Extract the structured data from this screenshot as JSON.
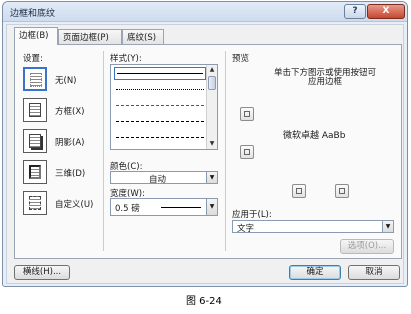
{
  "window": {
    "title": "边框和底纹",
    "help": "?",
    "close": "X"
  },
  "tabs": [
    {
      "label": "边框(B)"
    },
    {
      "label": "页面边框(P)"
    },
    {
      "label": "底纹(S)"
    }
  ],
  "settings": {
    "label": "设置:",
    "items": [
      {
        "label": "无(N)"
      },
      {
        "label": "方框(X)"
      },
      {
        "label": "阴影(A)"
      },
      {
        "label": "三维(D)"
      },
      {
        "label": "自定义(U)"
      }
    ]
  },
  "style": {
    "label": "样式(Y):",
    "up": "▲",
    "down": "▼"
  },
  "color": {
    "label": "颜色(C):",
    "value": "自动",
    "arrow": "▼"
  },
  "width": {
    "label": "宽度(W):",
    "value": "0.5 磅",
    "arrow": "▼"
  },
  "preview": {
    "label": "预览",
    "instruction_line1": "单击下方图示或使用按钮可",
    "instruction_line2": "应用边框",
    "sample": "微软卓越 AaBb"
  },
  "apply_to": {
    "label": "应用于(L):",
    "value": "文字",
    "arrow": "▼"
  },
  "buttons": {
    "options": "选项(O)...",
    "horizontal_line": "横线(H)...",
    "ok": "确定",
    "cancel": "取消"
  },
  "caption": "图 6-24"
}
